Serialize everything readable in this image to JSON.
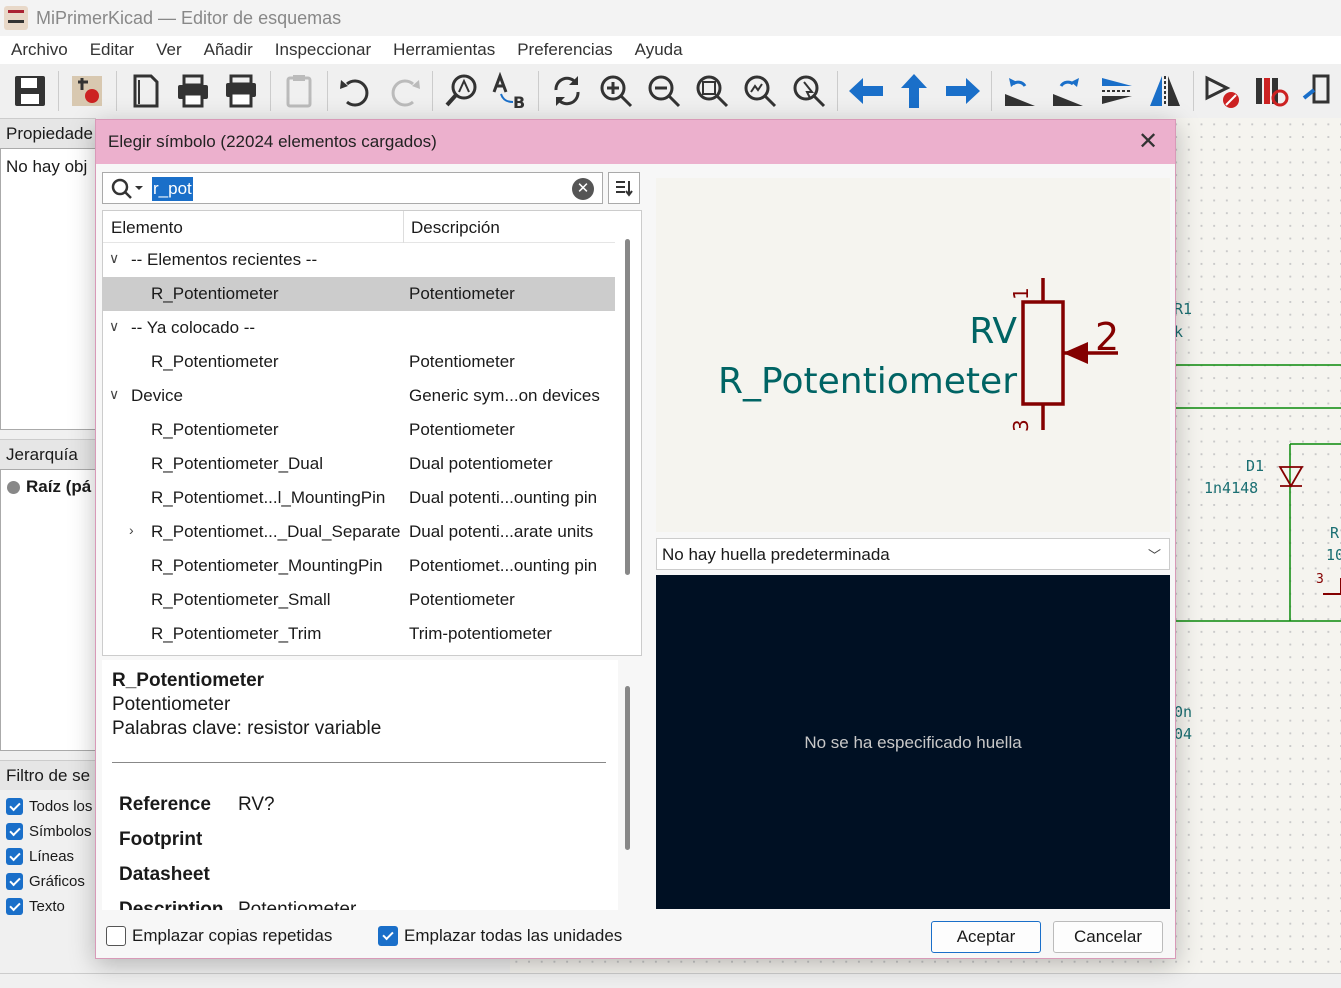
{
  "window": {
    "title": "MiPrimerKicad — Editor de esquemas"
  },
  "menu": [
    "Archivo",
    "Editar",
    "Ver",
    "Añadir",
    "Inspeccionar",
    "Herramientas",
    "Preferencias",
    "Ayuda"
  ],
  "toolbar": {
    "icons": [
      "save-icon",
      "schematic-setup-icon",
      "page-settings-icon",
      "print-icon",
      "plot-icon",
      "paste-icon",
      "undo-icon",
      "redo-icon",
      "find-icon",
      "find-replace-icon",
      "refresh-icon",
      "zoom-in-icon",
      "zoom-out-icon",
      "zoom-fit-icon",
      "zoom-objects-icon",
      "zoom-tool-icon",
      "back-icon",
      "up-icon",
      "forward-icon",
      "rotate-ccw-icon",
      "rotate-cw-icon",
      "mirror-v-icon",
      "mirror-h-icon",
      "erc-icon",
      "symbol-editor-icon",
      "symbol-browser-icon"
    ]
  },
  "left_panel": {
    "properties_header": "Propiedade",
    "properties_empty": "No hay obj",
    "hierarchy_header": "Jerarquía es",
    "hierarchy_root": "Raíz (pá",
    "filter_header": "Filtro de se",
    "filters": [
      "Todos los",
      "Símbolos",
      "Líneas",
      "Gráficos",
      "Texto"
    ]
  },
  "canvas_texts": {
    "r1_ref": "R1",
    "r1_val": "k",
    "d1_ref": "D1",
    "d1_val": "1n4148",
    "r_ref": "R",
    "r_val": "10",
    "pin3": "3",
    "c_val": "0n",
    "c_val2": "04"
  },
  "dialog": {
    "title": "Elegir símbolo (22024 elementos cargados)",
    "search_value": "r_pot",
    "columns": {
      "element": "Elemento",
      "description": "Descripción"
    },
    "rows": [
      {
        "kind": "group",
        "expanded": true,
        "name": "-- Elementos recientes --",
        "desc": ""
      },
      {
        "kind": "item",
        "selected": true,
        "name": "R_Potentiometer",
        "desc": "Potentiometer"
      },
      {
        "kind": "group",
        "expanded": true,
        "name": "-- Ya colocado --",
        "desc": ""
      },
      {
        "kind": "item",
        "name": "R_Potentiometer",
        "desc": "Potentiometer"
      },
      {
        "kind": "group",
        "expanded": true,
        "name": "Device",
        "desc": "Generic sym...on devices"
      },
      {
        "kind": "item",
        "name": "R_Potentiometer",
        "desc": "Potentiometer"
      },
      {
        "kind": "item",
        "name": "R_Potentiometer_Dual",
        "desc": "Dual potentiometer"
      },
      {
        "kind": "item",
        "name": "R_Potentiomet...l_MountingPin",
        "desc": "Dual potenti...ounting pin"
      },
      {
        "kind": "collapsed",
        "name": "R_Potentiomet..._Dual_Separate",
        "desc": "Dual potenti...arate units"
      },
      {
        "kind": "item",
        "name": "R_Potentiometer_MountingPin",
        "desc": "Potentiomet...ounting pin"
      },
      {
        "kind": "item",
        "name": "R_Potentiometer_Small",
        "desc": "Potentiometer"
      },
      {
        "kind": "item",
        "name": "R_Potentiometer_Trim",
        "desc": "Trim-potentiometer"
      }
    ],
    "details": {
      "name": "R_Potentiometer",
      "description": "Potentiometer",
      "keywords": "Palabras clave: resistor variable",
      "fields": [
        {
          "label": "Reference",
          "value": "RV?"
        },
        {
          "label": "Footprint",
          "value": ""
        },
        {
          "label": "Datasheet",
          "value": ""
        },
        {
          "label": "Description",
          "value": "Potentiometer"
        }
      ]
    },
    "preview": {
      "ref": "RV",
      "value": "R_Potentiometer",
      "pin1": "1",
      "pin2": "2",
      "pin3": "3",
      "symbol_color": "#840000",
      "text_color": "#006464"
    },
    "footprint_select": "No hay huella predeterminada",
    "footprint_message": "No se ha especificado huella",
    "options": {
      "place_repeated": {
        "label": "Emplazar copias repetidas",
        "checked": false
      },
      "place_all_units": {
        "label": "Emplazar todas las unidades",
        "checked": true
      }
    },
    "ok_label": "Aceptar",
    "cancel_label": "Cancelar"
  }
}
